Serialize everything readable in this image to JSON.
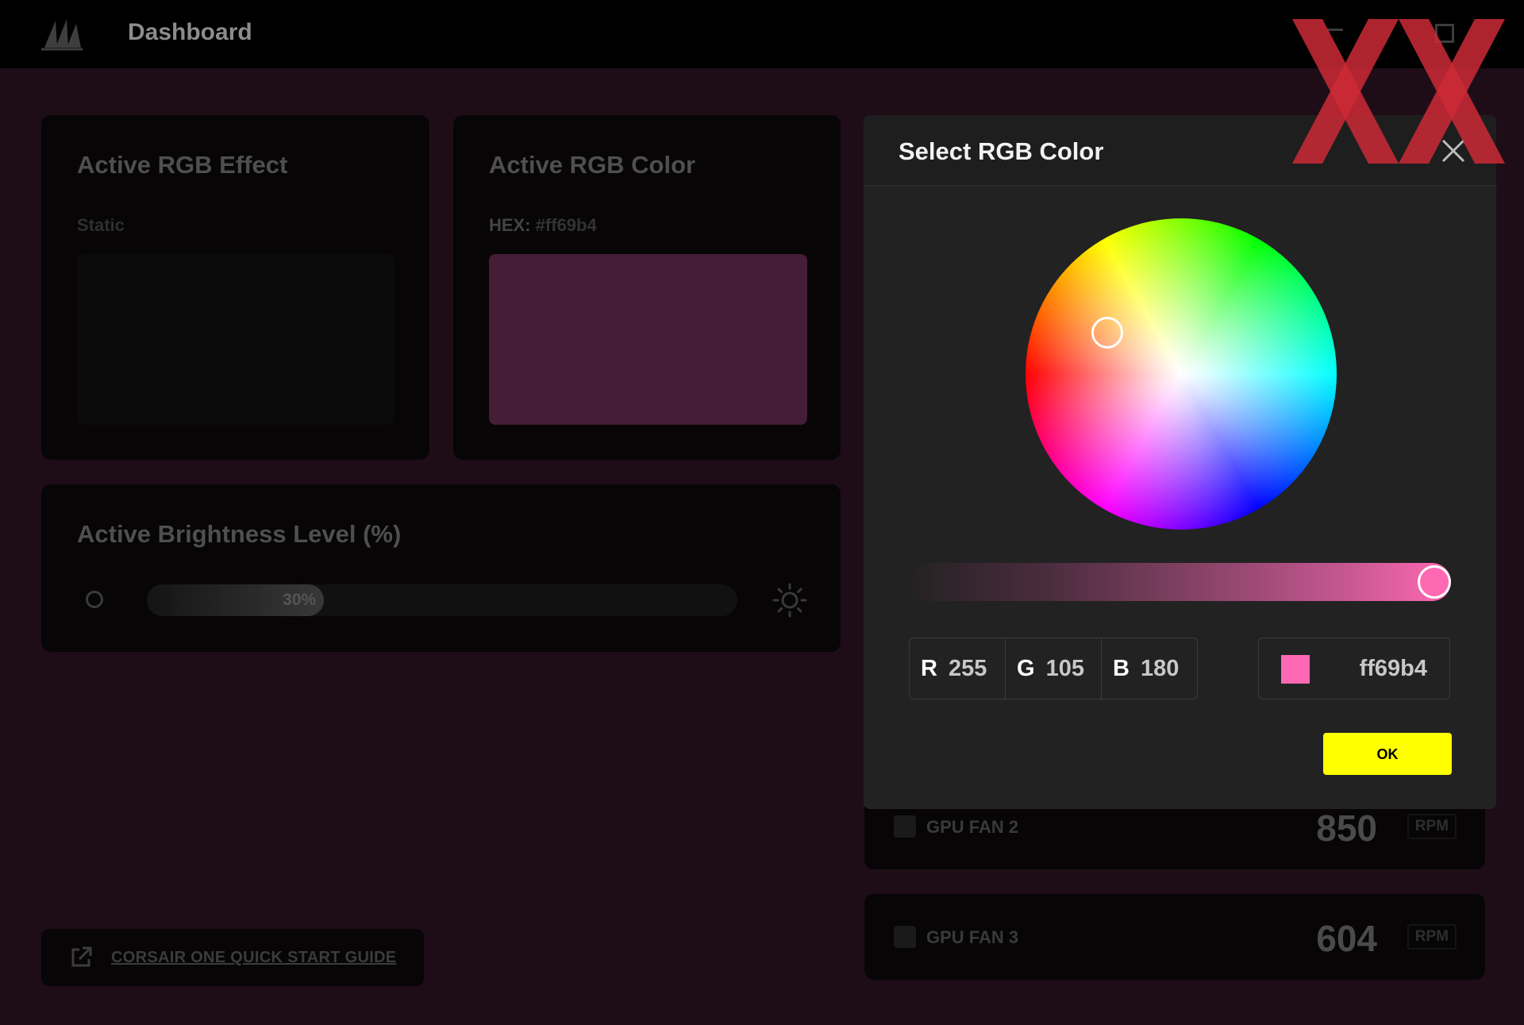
{
  "app": {
    "title": "Dashboard"
  },
  "effect_card": {
    "title": "Active RGB Effect",
    "effect": "Static"
  },
  "color_card": {
    "title": "Active RGB Color",
    "hex_label": "HEX:",
    "hex_value": "#ff69b4",
    "swatch_color": "#451d37"
  },
  "brightness": {
    "title": "Active Brightness Level (%)",
    "value_label": "30%",
    "value": 0.3
  },
  "guide": {
    "label": "CORSAIR ONE QUICK START GUIDE"
  },
  "fans": [
    {
      "name": "GPU FAN 2",
      "value": "850",
      "unit": "RPM"
    },
    {
      "name": "GPU FAN 3",
      "value": "604",
      "unit": "RPM"
    }
  ],
  "dialog": {
    "title": "Select RGB Color",
    "rgb": [
      {
        "label": "R",
        "value": "255"
      },
      {
        "label": "G",
        "value": "105"
      },
      {
        "label": "B",
        "value": "180"
      }
    ],
    "hex": "ff69b4",
    "selected_color": "#ff69b4",
    "shade_level": 1.0,
    "ok_label": "OK"
  },
  "icons": {
    "logo": "corsair-sails-icon",
    "close": "close-icon",
    "external_link": "external-link-icon",
    "brightness_low": "circle-icon",
    "brightness_high": "sun-icon",
    "fan": "fan-icon"
  },
  "colors": {
    "accent_yellow": "#ffff00",
    "background": "#1e0d17",
    "watermark_red": "#cc2a36"
  }
}
